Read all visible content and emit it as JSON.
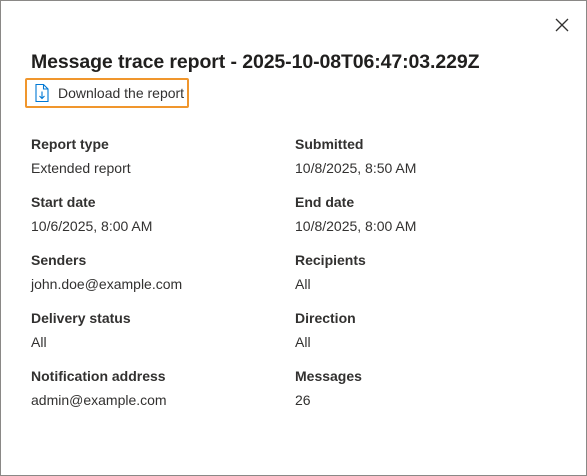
{
  "dialog": {
    "title": "Message trace report - 2025-10-08T06:47:03.229Z",
    "close_icon": "close-icon",
    "download": {
      "label": "Download the report",
      "icon": "download-document-icon",
      "focus_color": "#f0962d"
    }
  },
  "fields": {
    "report_type": {
      "label": "Report type",
      "value": "Extended report"
    },
    "submitted": {
      "label": "Submitted",
      "value": "10/8/2025, 8:50 AM"
    },
    "start_date": {
      "label": "Start date",
      "value": "10/6/2025, 8:00 AM"
    },
    "end_date": {
      "label": "End date",
      "value": "10/8/2025, 8:00 AM"
    },
    "senders": {
      "label": "Senders",
      "value": "john.doe@example.com"
    },
    "recipients": {
      "label": "Recipients",
      "value": "All"
    },
    "delivery_status": {
      "label": "Delivery status",
      "value": "All"
    },
    "direction": {
      "label": "Direction",
      "value": "All"
    },
    "notification_address": {
      "label": "Notification address",
      "value": "admin@example.com"
    },
    "messages": {
      "label": "Messages",
      "value": "26"
    }
  }
}
